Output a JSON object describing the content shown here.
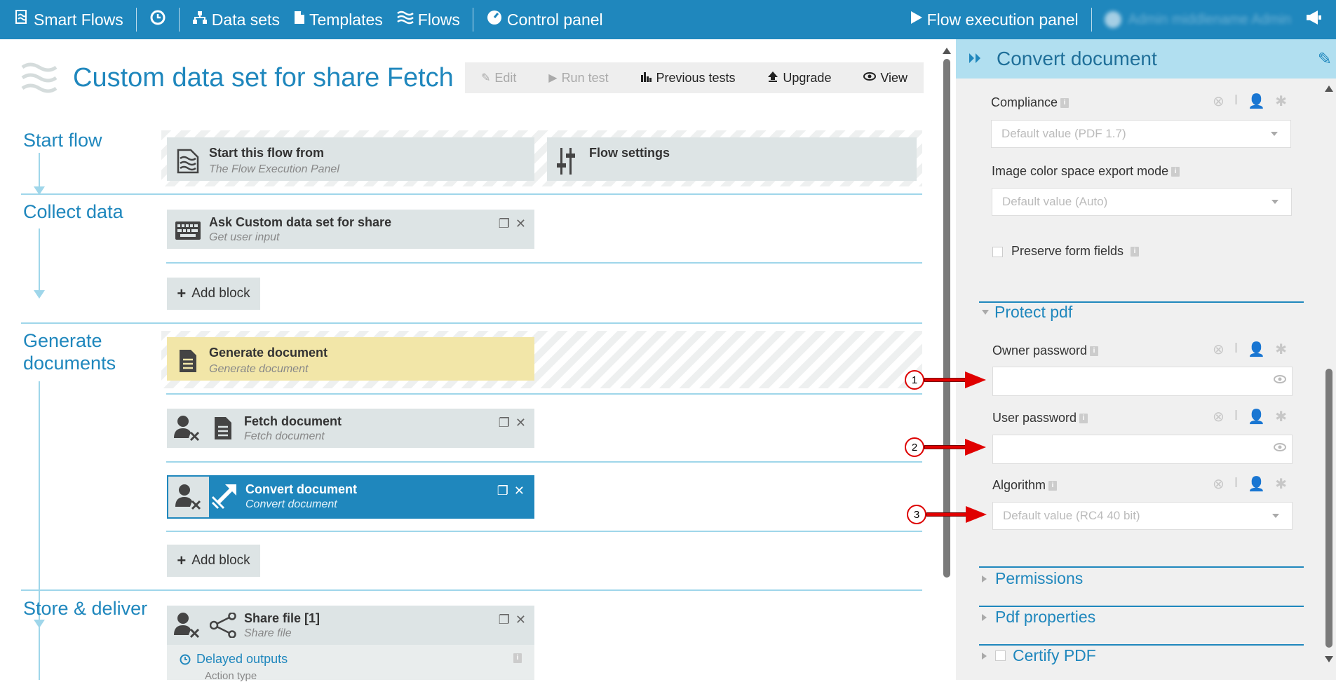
{
  "topbar": {
    "brand": "Smart Flows",
    "nav": {
      "datasets": "Data sets",
      "templates": "Templates",
      "flows": "Flows",
      "control_panel": "Control panel"
    },
    "flow_exec": "Flow execution panel",
    "user": "Admin middlename Admin"
  },
  "flow": {
    "title": "Custom data set for share Fetch",
    "actions": {
      "edit": "Edit",
      "run_test": "Run test",
      "previous_tests": "Previous tests",
      "upgrade": "Upgrade",
      "view": "View"
    }
  },
  "sections": {
    "start": {
      "label": "Start flow",
      "start_block": {
        "title": "Start this flow from",
        "subtitle": "The Flow Execution Panel"
      },
      "settings_block": {
        "title": "Flow settings"
      }
    },
    "collect": {
      "label": "Collect data",
      "ask_block": {
        "title": "Ask Custom data set for share",
        "subtitle": "Get user input"
      },
      "add_block": "Add block"
    },
    "generate": {
      "label_line1": "Generate",
      "label_line2": "documents",
      "gen_block": {
        "title": "Generate document",
        "subtitle": "Generate document"
      },
      "fetch_block": {
        "title": "Fetch document",
        "subtitle": "Fetch document"
      },
      "convert_block": {
        "title": "Convert document",
        "subtitle": "Convert document"
      },
      "add_block": "Add block"
    },
    "store": {
      "label": "Store & deliver",
      "share_block": {
        "title": "Share file [1]",
        "subtitle": "Share file"
      },
      "delayed_outputs": "Delayed outputs",
      "action_type": "Action type"
    }
  },
  "panel": {
    "title": "Convert document",
    "compliance": {
      "label": "Compliance",
      "value": "Default value (PDF 1.7)"
    },
    "color_space": {
      "label": "Image color space export mode",
      "value": "Default value (Auto)"
    },
    "preserve_form": {
      "label": "Preserve form fields"
    },
    "protect_pdf": {
      "label": "Protect pdf",
      "owner_password": {
        "label": "Owner password",
        "value": ""
      },
      "user_password": {
        "label": "User password",
        "value": ""
      },
      "algorithm": {
        "label": "Algorithm",
        "value": "Default value (RC4 40 bit)"
      }
    },
    "permissions": "Permissions",
    "pdf_properties": "Pdf properties",
    "certify_pdf": "Certify PDF"
  },
  "annotations": [
    "1",
    "2",
    "3"
  ],
  "colors": {
    "primary": "#1f87bd",
    "panel_header": "#b1dff0",
    "block": "#dde4e5",
    "yellow_block": "#f2e6a8",
    "arrow": "#e00000"
  }
}
